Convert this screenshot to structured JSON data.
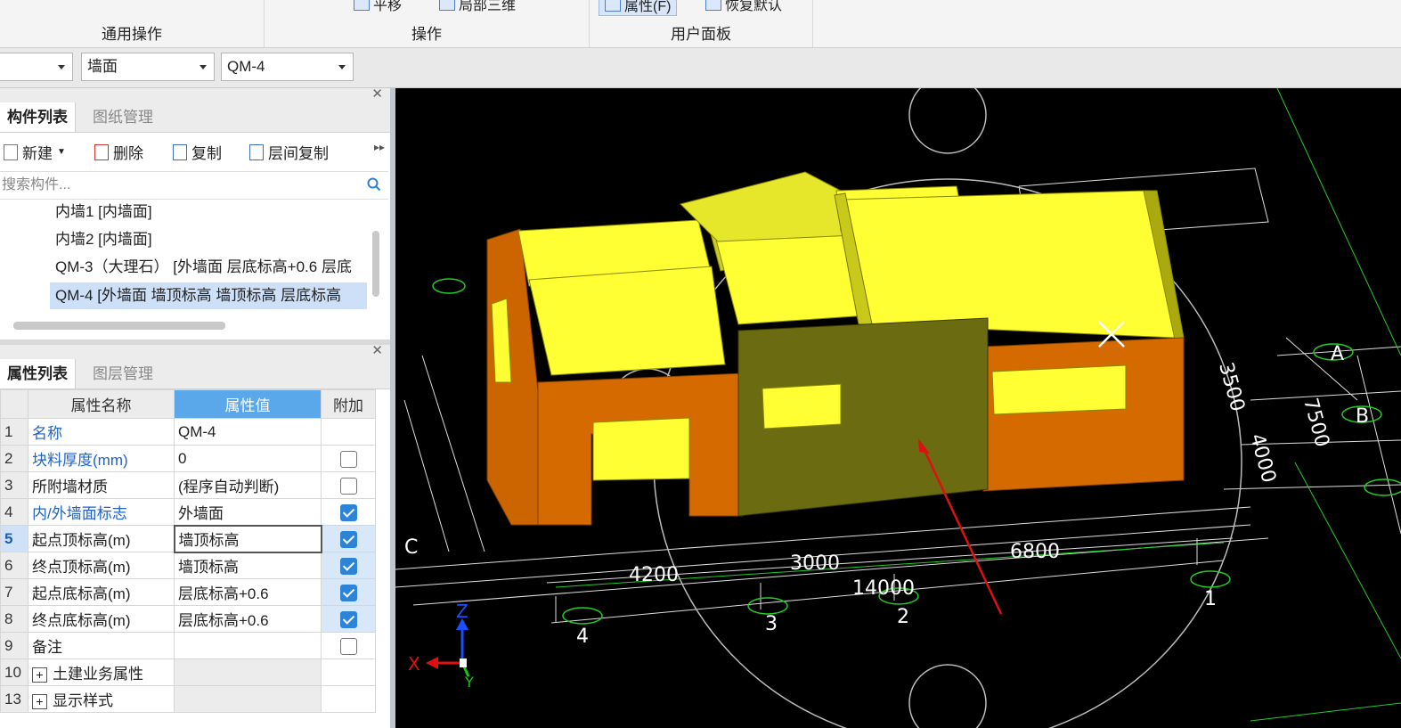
{
  "ribbon": {
    "groups": [
      {
        "label": "通用操作"
      },
      {
        "label": "操作"
      },
      {
        "label": "用户面板"
      }
    ],
    "buttons": {
      "move": "平移",
      "local3d": "局部三维",
      "properties": "属性(F)",
      "restore": "恢复默认"
    }
  },
  "selectors": {
    "floor": "",
    "type": "墙面",
    "component": "QM-4"
  },
  "component_panel": {
    "tabs": [
      "构件列表",
      "图纸管理"
    ],
    "toolbar": {
      "new": "新建",
      "delete": "删除",
      "copy": "复制",
      "floor_copy": "层间复制"
    },
    "search_placeholder": "搜索构件...",
    "items": [
      "内墙1 [内墙面]",
      "内墙2 [内墙面]",
      "QM-3（大理石） [外墙面 层底标高+0.6 层底",
      "QM-4 [外墙面 墙顶标高 墙顶标高 层底标高"
    ]
  },
  "property_panel": {
    "tabs": [
      "属性列表",
      "图层管理"
    ],
    "headers": {
      "name": "属性名称",
      "value": "属性值",
      "extra": "附加"
    },
    "rows": [
      {
        "num": "1",
        "name": "名称",
        "value": "QM-4"
      },
      {
        "num": "2",
        "name": "块料厚度(mm)",
        "value": "0"
      },
      {
        "num": "3",
        "name": "所附墙材质",
        "value": "(程序自动判断)"
      },
      {
        "num": "4",
        "name": "内/外墙面标志",
        "value": "外墙面"
      },
      {
        "num": "5",
        "name": "起点顶标高(m)",
        "value": "墙顶标高"
      },
      {
        "num": "6",
        "name": "终点顶标高(m)",
        "value": "墙顶标高"
      },
      {
        "num": "7",
        "name": "起点底标高(m)",
        "value": "层底标高+0.6"
      },
      {
        "num": "8",
        "name": "终点底标高(m)",
        "value": "层底标高+0.6"
      },
      {
        "num": "9",
        "name": "备注",
        "value": ""
      },
      {
        "num": "10",
        "name": "土建业务属性",
        "value": ""
      },
      {
        "num": "13",
        "name": "显示样式",
        "value": ""
      }
    ]
  },
  "viewport": {
    "axis_labels": {
      "x": "X",
      "y": "Y",
      "z": "Z"
    },
    "grid_numbers": [
      "4",
      "3",
      "2",
      "1"
    ],
    "grid_letters": [
      "A",
      "B",
      "C"
    ],
    "dimensions": [
      "4200",
      "3000",
      "6800",
      "14000",
      "3500",
      "4000",
      "7500"
    ],
    "colors": {
      "wall_yellow": "#ffff33",
      "wall_orange": "#d56a00",
      "wall_olive": "#6b6b12",
      "grid_green": "#22cc22",
      "arrow_red": "#dd1111"
    }
  }
}
